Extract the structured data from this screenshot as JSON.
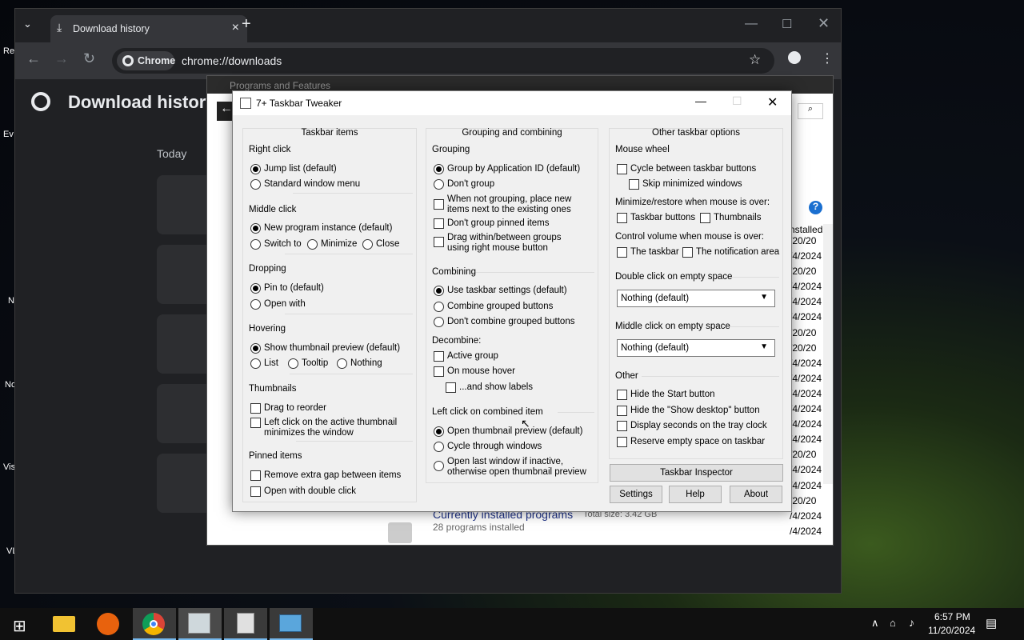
{
  "desktop": {
    "icons": [
      "Re",
      "Ev",
      "N",
      "No",
      "Vis",
      "VL"
    ]
  },
  "chrome": {
    "tab_title": "Download history",
    "new_tab": "+",
    "url_chip": "Chrome",
    "url": "chrome://downloads",
    "page_title": "Download history",
    "section_today": "Today"
  },
  "programs": {
    "title": "Programs and Features",
    "dates": [
      "/20/20",
      "/4/2024",
      "/20/20",
      "/4/2024",
      "/4/2024",
      "/4/2024",
      "/20/20",
      "/20/20",
      "/4/2024",
      "/4/2024",
      "/4/2024",
      "/4/2024",
      "/4/2024",
      "/4/2024",
      "/20/20",
      "/4/2024",
      "/4/2024",
      "/20/20",
      "/4/2024",
      "/4/2024"
    ],
    "installed_header": "nstalled",
    "footer_title": "Currently installed programs",
    "footer_size": "Total size:   3.42 GB",
    "footer_count": "28 programs installed"
  },
  "tweaker": {
    "title": "7+ Taskbar Tweaker",
    "col1": {
      "header": "Taskbar items",
      "right_click": {
        "title": "Right click",
        "opts": [
          "Jump list (default)",
          "Standard window menu"
        ]
      },
      "middle_click": {
        "title": "Middle click",
        "opts": [
          "New program instance (default)",
          "Switch to",
          "Minimize",
          "Close"
        ]
      },
      "dropping": {
        "title": "Dropping",
        "opts": [
          "Pin to (default)",
          "Open with"
        ]
      },
      "hovering": {
        "title": "Hovering",
        "opts": [
          "Show thumbnail preview (default)",
          "List",
          "Tooltip",
          "Nothing"
        ]
      },
      "thumbnails": {
        "title": "Thumbnails",
        "opts": [
          "Drag to reorder",
          "Left click on the active thumbnail",
          "minimizes the window"
        ]
      },
      "pinned": {
        "title": "Pinned items",
        "opts": [
          "Remove extra gap between items",
          "Open with double click"
        ]
      }
    },
    "col2": {
      "header": "Grouping and combining",
      "grouping": {
        "title": "Grouping",
        "opts": [
          "Group by Application ID (default)",
          "Don't group",
          "When not grouping, place new",
          "items next to the existing ones",
          "Don't group pinned items",
          "Drag within/between groups",
          "using right mouse button"
        ]
      },
      "combining": {
        "title": "Combining",
        "opts": [
          "Use taskbar settings (default)",
          "Combine grouped buttons",
          "Don't combine grouped buttons"
        ]
      },
      "decombine": {
        "title": "Decombine:",
        "opts": [
          "Active group",
          "On mouse hover",
          "...and show labels"
        ]
      },
      "leftclick": {
        "title": "Left click on combined item",
        "opts": [
          "Open thumbnail preview (default)",
          "Cycle through windows",
          "Open last window if inactive,",
          "otherwise open thumbnail preview"
        ]
      }
    },
    "col3": {
      "header": "Other taskbar options",
      "wheel": {
        "title": "Mouse wheel",
        "opts": [
          "Cycle between taskbar buttons",
          "Skip minimized windows"
        ]
      },
      "minrestore": {
        "title": "Minimize/restore when mouse is over:",
        "opts": [
          "Taskbar buttons",
          "Thumbnails"
        ]
      },
      "volume": {
        "title": "Control volume when mouse is over:",
        "opts": [
          "The taskbar",
          "The notification area"
        ]
      },
      "dblclick": {
        "title": "Double click on empty space",
        "value": "Nothing (default)"
      },
      "midclick": {
        "title": "Middle click on empty space",
        "value": "Nothing (default)"
      },
      "other": {
        "title": "Other",
        "opts": [
          "Hide the Start button",
          "Hide the \"Show desktop\" button",
          "Display seconds on the tray clock",
          "Reserve empty space on taskbar"
        ]
      },
      "inspector": "Taskbar Inspector",
      "settings": "Settings",
      "help": "Help",
      "about": "About"
    }
  },
  "taskbar": {
    "time": "6:57 PM",
    "date": "11/20/2024"
  }
}
